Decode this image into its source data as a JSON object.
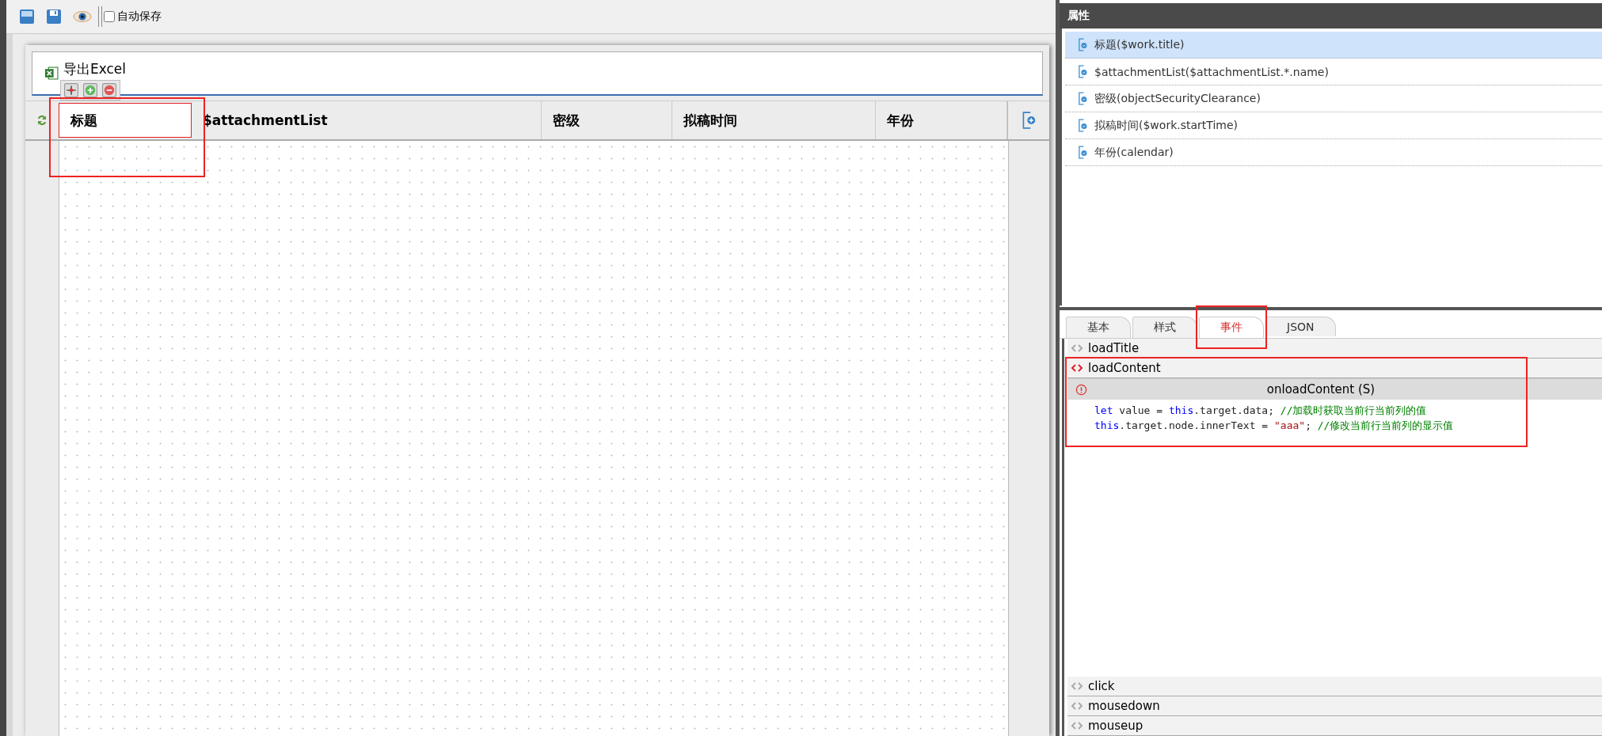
{
  "toolbar": {
    "autosave": {
      "label": "自动保存",
      "checked": false
    }
  },
  "form": {
    "action": {
      "label": "导出Excel"
    },
    "columns": [
      {
        "label": "标题",
        "selected": true
      },
      {
        "label": "$attachmentList",
        "selected": false
      },
      {
        "label": "密级",
        "selected": false
      },
      {
        "label": "拟稿时间",
        "selected": false
      },
      {
        "label": "年份",
        "selected": false
      }
    ]
  },
  "properties": {
    "title": "属性",
    "items": [
      {
        "label": "标题($work.title)",
        "selected": true
      },
      {
        "label": "$attachmentList($attachmentList.*.name)",
        "selected": false
      },
      {
        "label": "密级(objectSecurityClearance)",
        "selected": false
      },
      {
        "label": "拟稿时间($work.startTime)",
        "selected": false
      },
      {
        "label": "年份(calendar)",
        "selected": false
      }
    ]
  },
  "tabs": [
    {
      "label": "基本",
      "selected": false
    },
    {
      "label": "样式",
      "selected": false
    },
    {
      "label": "事件",
      "selected": true
    },
    {
      "label": "JSON",
      "selected": false
    }
  ],
  "events_top": [
    {
      "name": "loadTitle",
      "expanded": false
    },
    {
      "name": "loadContent",
      "expanded": true,
      "script_title": "onloadContent (S)",
      "code": [
        [
          {
            "text": "let",
            "kind": "keyword"
          },
          {
            "text": " value = ",
            "kind": "plain"
          },
          {
            "text": "this",
            "kind": "keyword"
          },
          {
            "text": ".target.data; ",
            "kind": "plain"
          },
          {
            "text": "//加载时获取当前行当前列的值",
            "kind": "comment"
          }
        ],
        [
          {
            "text": "this",
            "kind": "keyword"
          },
          {
            "text": ".target.node.innerText = ",
            "kind": "plain"
          },
          {
            "text": "\"aaa\"",
            "kind": "string"
          },
          {
            "text": "; ",
            "kind": "plain"
          },
          {
            "text": "//修改当前行当前列的显示值",
            "kind": "comment"
          }
        ]
      ]
    }
  ],
  "events_bottom": [
    {
      "name": "click",
      "expanded": false
    },
    {
      "name": "mousedown",
      "expanded": false
    },
    {
      "name": "mouseup",
      "expanded": false
    }
  ]
}
